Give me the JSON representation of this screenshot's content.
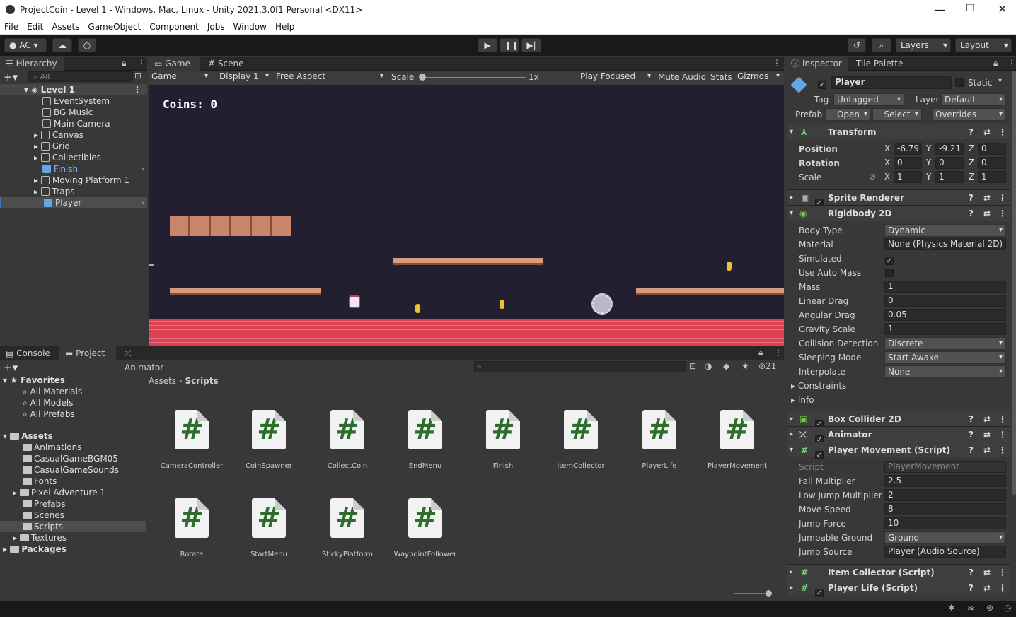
{
  "window": {
    "title": "ProjectCoin - Level 1 - Windows, Mac, Linux - Unity 2021.3.0f1 Personal <DX11>"
  },
  "menu": [
    "File",
    "Edit",
    "Assets",
    "GameObject",
    "Component",
    "Jobs",
    "Window",
    "Help"
  ],
  "toolbar": {
    "account": "AC",
    "layers": "Layers",
    "layout": "Layout"
  },
  "hierarchy": {
    "tab": "Hierarchy",
    "search_placeholder": "All",
    "scene": "Level 1",
    "items": [
      "EventSystem",
      "BG Music",
      "Main Camera",
      "Canvas",
      "Grid",
      "Collectibles",
      "Finish",
      "Moving Platform 1",
      "Traps",
      "Player"
    ]
  },
  "game": {
    "tabs": [
      "Game",
      "Scene"
    ],
    "mode": "Game",
    "display": "Display 1",
    "aspect": "Free Aspect",
    "scale_label": "Scale",
    "scale_value": "1x",
    "play_focused": "Play Focused",
    "mute": "Mute Audio",
    "stats": "Stats",
    "gizmos": "Gizmos",
    "coins_text": "Coins: 0"
  },
  "project": {
    "tabs": [
      "Console",
      "Project",
      "Animator"
    ],
    "hidden_count": "21",
    "breadcrumb": [
      "Assets",
      "Scripts"
    ],
    "favorites_label": "Favorites",
    "favorites": [
      "All Materials",
      "All Models",
      "All Prefabs"
    ],
    "assets_label": "Assets",
    "folders": [
      "Animations",
      "CasualGameBGM05",
      "CasualGameSounds",
      "Fonts",
      "Pixel Adventure 1",
      "Prefabs",
      "Scenes",
      "Scripts",
      "Textures"
    ],
    "packages_label": "Packages",
    "scripts": [
      "CameraController",
      "CoinSpawner",
      "CollectCoin",
      "EndMenu",
      "Finish",
      "ItemCollector",
      "PlayerLife",
      "PlayerMovement",
      "Rotate",
      "StartMenu",
      "StickyPlatform",
      "WaypointFollower"
    ]
  },
  "inspector": {
    "tabs": [
      "Inspector",
      "Tile Palette"
    ],
    "name": "Player",
    "static": "Static",
    "tag_label": "Tag",
    "tag": "Untagged",
    "layer_label": "Layer",
    "layer": "Default",
    "prefab_label": "Prefab",
    "prefab_open": "Open",
    "prefab_select": "Select",
    "prefab_overrides": "Overrides",
    "transform": {
      "title": "Transform",
      "position_label": "Position",
      "position": [
        "-6.79",
        "-9.21",
        "0"
      ],
      "rotation_label": "Rotation",
      "rotation": [
        "0",
        "0",
        "0"
      ],
      "scale_label": "Scale",
      "scale": [
        "1",
        "1",
        "1"
      ]
    },
    "sprite_renderer": "Sprite Renderer",
    "rigidbody": {
      "title": "Rigidbody 2D",
      "rows": [
        {
          "label": "Body Type",
          "value": "Dynamic",
          "kind": "drop"
        },
        {
          "label": "Material",
          "value": "None (Physics Material 2D)",
          "kind": "field"
        },
        {
          "label": "Simulated",
          "value": "✓",
          "kind": "check"
        },
        {
          "label": "Use Auto Mass",
          "value": "",
          "kind": "check"
        },
        {
          "label": "Mass",
          "value": "1",
          "kind": "field"
        },
        {
          "label": "Linear Drag",
          "value": "0",
          "kind": "field"
        },
        {
          "label": "Angular Drag",
          "value": "0.05",
          "kind": "field"
        },
        {
          "label": "Gravity Scale",
          "value": "1",
          "kind": "field"
        },
        {
          "label": "Collision Detection",
          "value": "Discrete",
          "kind": "drop"
        },
        {
          "label": "Sleeping Mode",
          "value": "Start Awake",
          "kind": "drop"
        },
        {
          "label": "Interpolate",
          "value": "None",
          "kind": "drop"
        }
      ],
      "constraints": "Constraints",
      "info": "Info"
    },
    "box_collider": "Box Collider 2D",
    "animator": "Animator",
    "player_movement": {
      "title": "Player Movement (Script)",
      "rows": [
        {
          "label": "Script",
          "value": "PlayerMovement",
          "kind": "field"
        },
        {
          "label": "Fall Multiplier",
          "value": "2.5",
          "kind": "field"
        },
        {
          "label": "Low Jump Multiplier",
          "value": "2",
          "kind": "field"
        },
        {
          "label": "Move Speed",
          "value": "8",
          "kind": "field"
        },
        {
          "label": "Jump Force",
          "value": "10",
          "kind": "field"
        },
        {
          "label": "Jumpable Ground",
          "value": "Ground",
          "kind": "drop"
        },
        {
          "label": "Jump Source",
          "value": "Player (Audio Source)",
          "kind": "field"
        }
      ]
    },
    "item_collector": "Item Collector (Script)",
    "player_life": "Player Life (Script)"
  }
}
